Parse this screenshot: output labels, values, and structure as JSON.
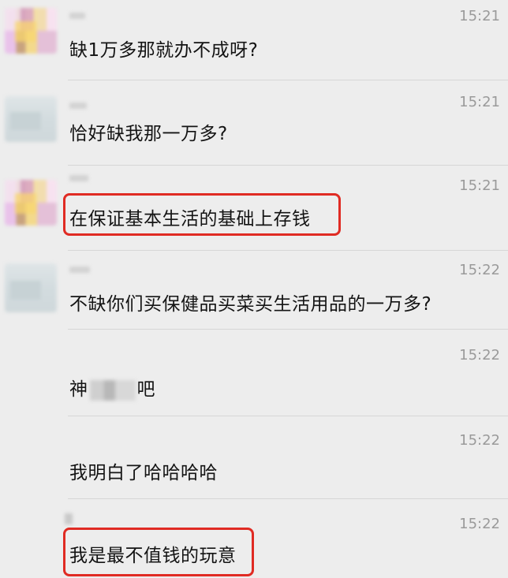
{
  "messages": [
    {
      "time": "15:21",
      "text": "缺1万多那就办不成呀?"
    },
    {
      "time": "15:21",
      "text": "恰好缺我那一万多?"
    },
    {
      "time": "15:21",
      "text": "在保证基本生活的基础上存钱"
    },
    {
      "time": "15:22",
      "text": "不缺你们买保健品买菜买生活用品的一万多?"
    },
    {
      "time": "15:22",
      "text_before": "神",
      "text_after": "吧"
    },
    {
      "time": "15:22",
      "text": "我明白了哈哈哈哈"
    },
    {
      "time": "15:22",
      "text": "我是最不值钱的玩意"
    }
  ],
  "colors": {
    "background": "#ededed",
    "highlight_border": "#e02b23",
    "time": "#9a9a9a",
    "text": "#141414"
  }
}
